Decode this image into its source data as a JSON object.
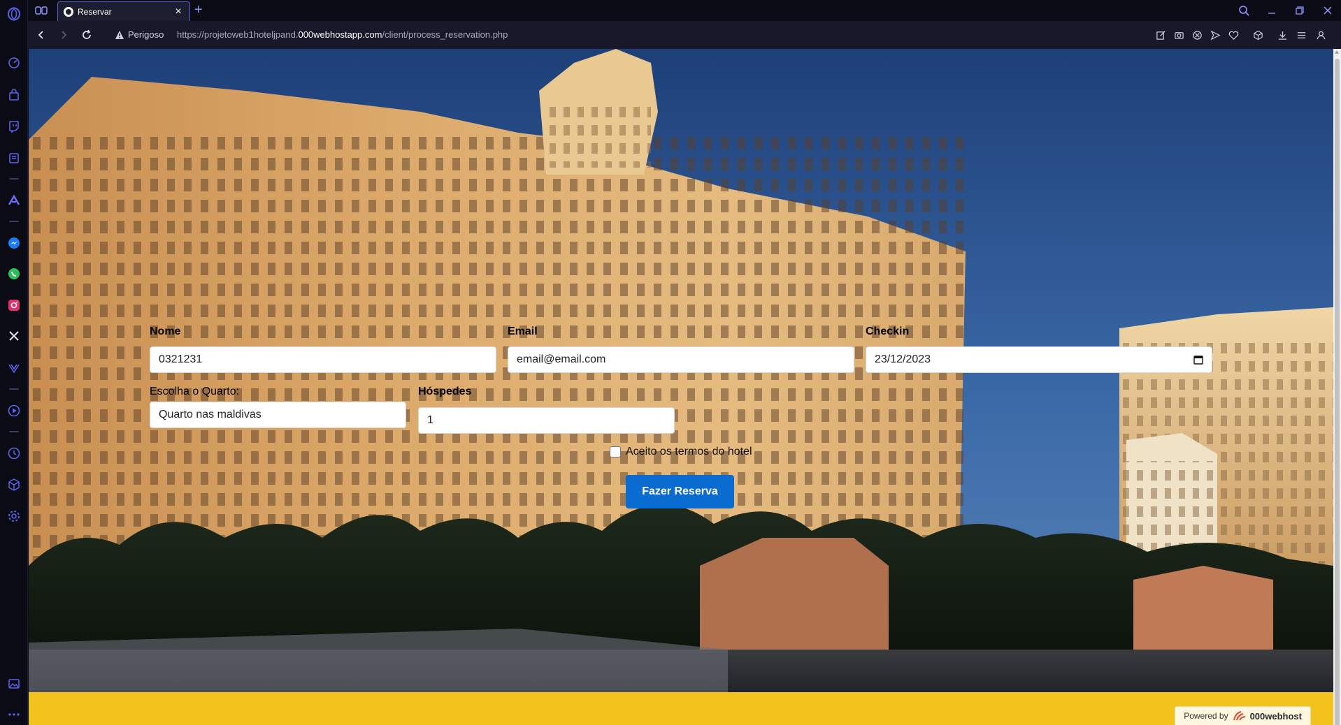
{
  "browser": {
    "tab": {
      "title": "Reservar"
    },
    "address": {
      "security_label": "Perigoso",
      "url_prefix": "https://projetoweb1hoteljpand.",
      "url_host": "000webhostapp.com",
      "url_path": "/client/process_reservation.php"
    },
    "sidebar_icons": [
      "speed-dial-icon",
      "shopping-bag-icon",
      "twitch-icon",
      "notes-icon",
      "aria-icon",
      "messenger-icon",
      "whatsapp-icon",
      "instagram-icon",
      "x-icon",
      "vk-icon",
      "player-icon",
      "history-icon",
      "cube-icon",
      "settings-icon",
      "image-icon",
      "more-icon"
    ],
    "accent_color": "#8f95ff"
  },
  "form": {
    "nome": {
      "label": "Nome",
      "value": "0321231"
    },
    "email": {
      "label": "Email",
      "value": "email@email.com"
    },
    "checkin": {
      "label": "Checkin",
      "value": "23/12/2023"
    },
    "quarto": {
      "label": "Escolha o Quarto:",
      "value": "Quarto nas maldivas"
    },
    "hospedes": {
      "label": "Hóspedes",
      "value": "1"
    },
    "terms": {
      "label": "Aceito os termos do hotel",
      "checked": false
    },
    "submit_label": "Fazer Reserva",
    "button_color": "#0a6bd1"
  },
  "footer": {
    "powered_label": "Powered by",
    "brand": "000webhost",
    "color": "#f2c31c"
  }
}
